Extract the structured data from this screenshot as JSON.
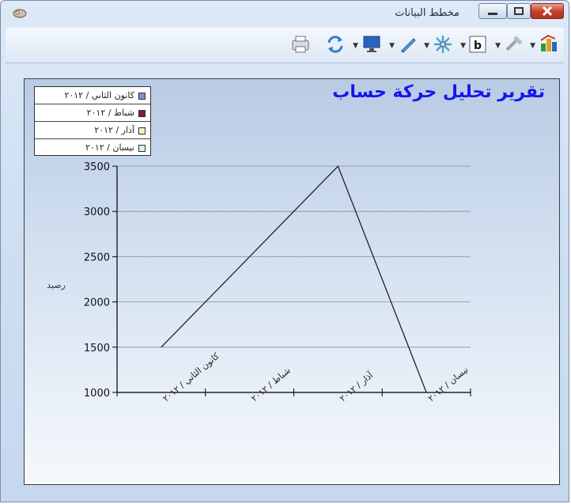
{
  "window": {
    "title": "مخطط البيانات"
  },
  "toolbar": {
    "icons": [
      "chart-type-icon",
      "hammer-tool-icon",
      "bold-toggle-icon",
      "tools-icon",
      "pen-icon",
      "monitor-icon",
      "refresh-icon",
      "print-icon"
    ]
  },
  "colors": {
    "title": "#1515ee",
    "line": "#222222",
    "grid": "#8c8c8c"
  },
  "chart_data": {
    "type": "line",
    "title": "تقرير تحليل حركة حساب",
    "ylabel": "رصيد",
    "xlabel": "",
    "categories": [
      "كانون الثاني / ٢٠١٢",
      "شباط / ٢٠١٢",
      "آذار / ٢٠١٢",
      "نيسان / ٢٠١٢"
    ],
    "x_tick_labels": [
      "كانون الثاني / ٢٠١٢",
      "شباط / ٢٠١٢",
      "آذار / ٢٠١٢",
      "نيسان / ٢٠١٢"
    ],
    "legend": [
      {
        "label": "كانون الثاني / ٢٠١٢",
        "color": "#8e8bd6"
      },
      {
        "label": "شباط / ٢٠١٢",
        "color": "#7a1f4a"
      },
      {
        "label": "آذار / ٢٠١٢",
        "color": "#f6f3b8"
      },
      {
        "label": "نيسان / ٢٠١٢",
        "color": "#d7f1f3"
      }
    ],
    "legend_position": "top-left",
    "series": [
      {
        "values": [
          1500,
          2500,
          3500,
          1000
        ]
      }
    ],
    "ylim": [
      1000,
      3500
    ],
    "yticks": [
      1000,
      1500,
      2000,
      2500,
      3000,
      3500
    ],
    "grid": true
  }
}
